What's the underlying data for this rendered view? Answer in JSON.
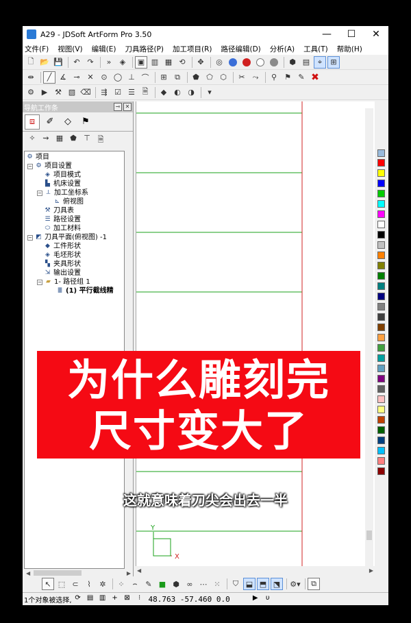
{
  "window": {
    "title": "A29 - JDSoft ArtForm Pro 3.50",
    "controls": {
      "minimize": "—",
      "maximize": "☐",
      "close": "✕"
    }
  },
  "menu": [
    "文件(F)",
    "视图(V)",
    "编辑(E)",
    "刀具路径(P)",
    "加工项目(R)",
    "路径编辑(D)",
    "分析(A)",
    "工具(T)",
    "帮助(H)"
  ],
  "toolbar": {
    "render_ball_colors": [
      "#3b6fd8",
      "#d02020",
      "#ffffff",
      "#8a8a8a"
    ]
  },
  "nav_panel": {
    "title": "导航工作条",
    "pin_icon": "pin-icon",
    "close_icon": "close-icon"
  },
  "tree": {
    "root": "项目",
    "project_settings": "项目设置",
    "project_mode": "项目模式",
    "machine_settings": "机床设置",
    "machining_coords": "加工坐标系",
    "top_view": "俯视图",
    "tool_table": "刀具表",
    "path_settings": "路径设置",
    "material": "加工材料",
    "tool_plane": "刀具平面(俯视图) -1",
    "workpiece_shape": "工件形状",
    "blank_shape": "毛坯形状",
    "fixture_shape": "夹具形状",
    "output_settings": "输出设置",
    "path_group": "1- 路径组 1",
    "path_item": "(1) 平行截线精"
  },
  "viewport": {
    "axis_x_label": "X",
    "axis_y_label": "Y",
    "axis_color_x": "#d02020",
    "axis_color_y": "#1aa01a",
    "grid_line_color": "#1aa01a",
    "boundary_line_color": "#d02020"
  },
  "palette_colors": [
    "#ff0000",
    "#ffff00",
    "#0000ff",
    "#00cc00",
    "#00ffff",
    "#ff00ff",
    "#ffffff",
    "#000000",
    "#c0c0c0",
    "#ff8000",
    "#808000",
    "#008000",
    "#008080",
    "#000080",
    "#808080",
    "#404040",
    "#804000",
    "#ffa040",
    "#40a040",
    "#00a0a0",
    "#60a0c0",
    "#800080",
    "#606060",
    "#ffc0c0",
    "#ffff80",
    "#c04000",
    "#006000",
    "#004080",
    "#00c0ff",
    "#ff8080",
    "#8b0000"
  ],
  "status": {
    "selection_text": "1个对象被选择,",
    "coords": "48.763 -57.460 0.0"
  },
  "overlay": {
    "banner_line1": "为什么雕刻完",
    "banner_line2": "尺寸变大了",
    "subtitle": "这就意味着刀尖会出去一半"
  }
}
